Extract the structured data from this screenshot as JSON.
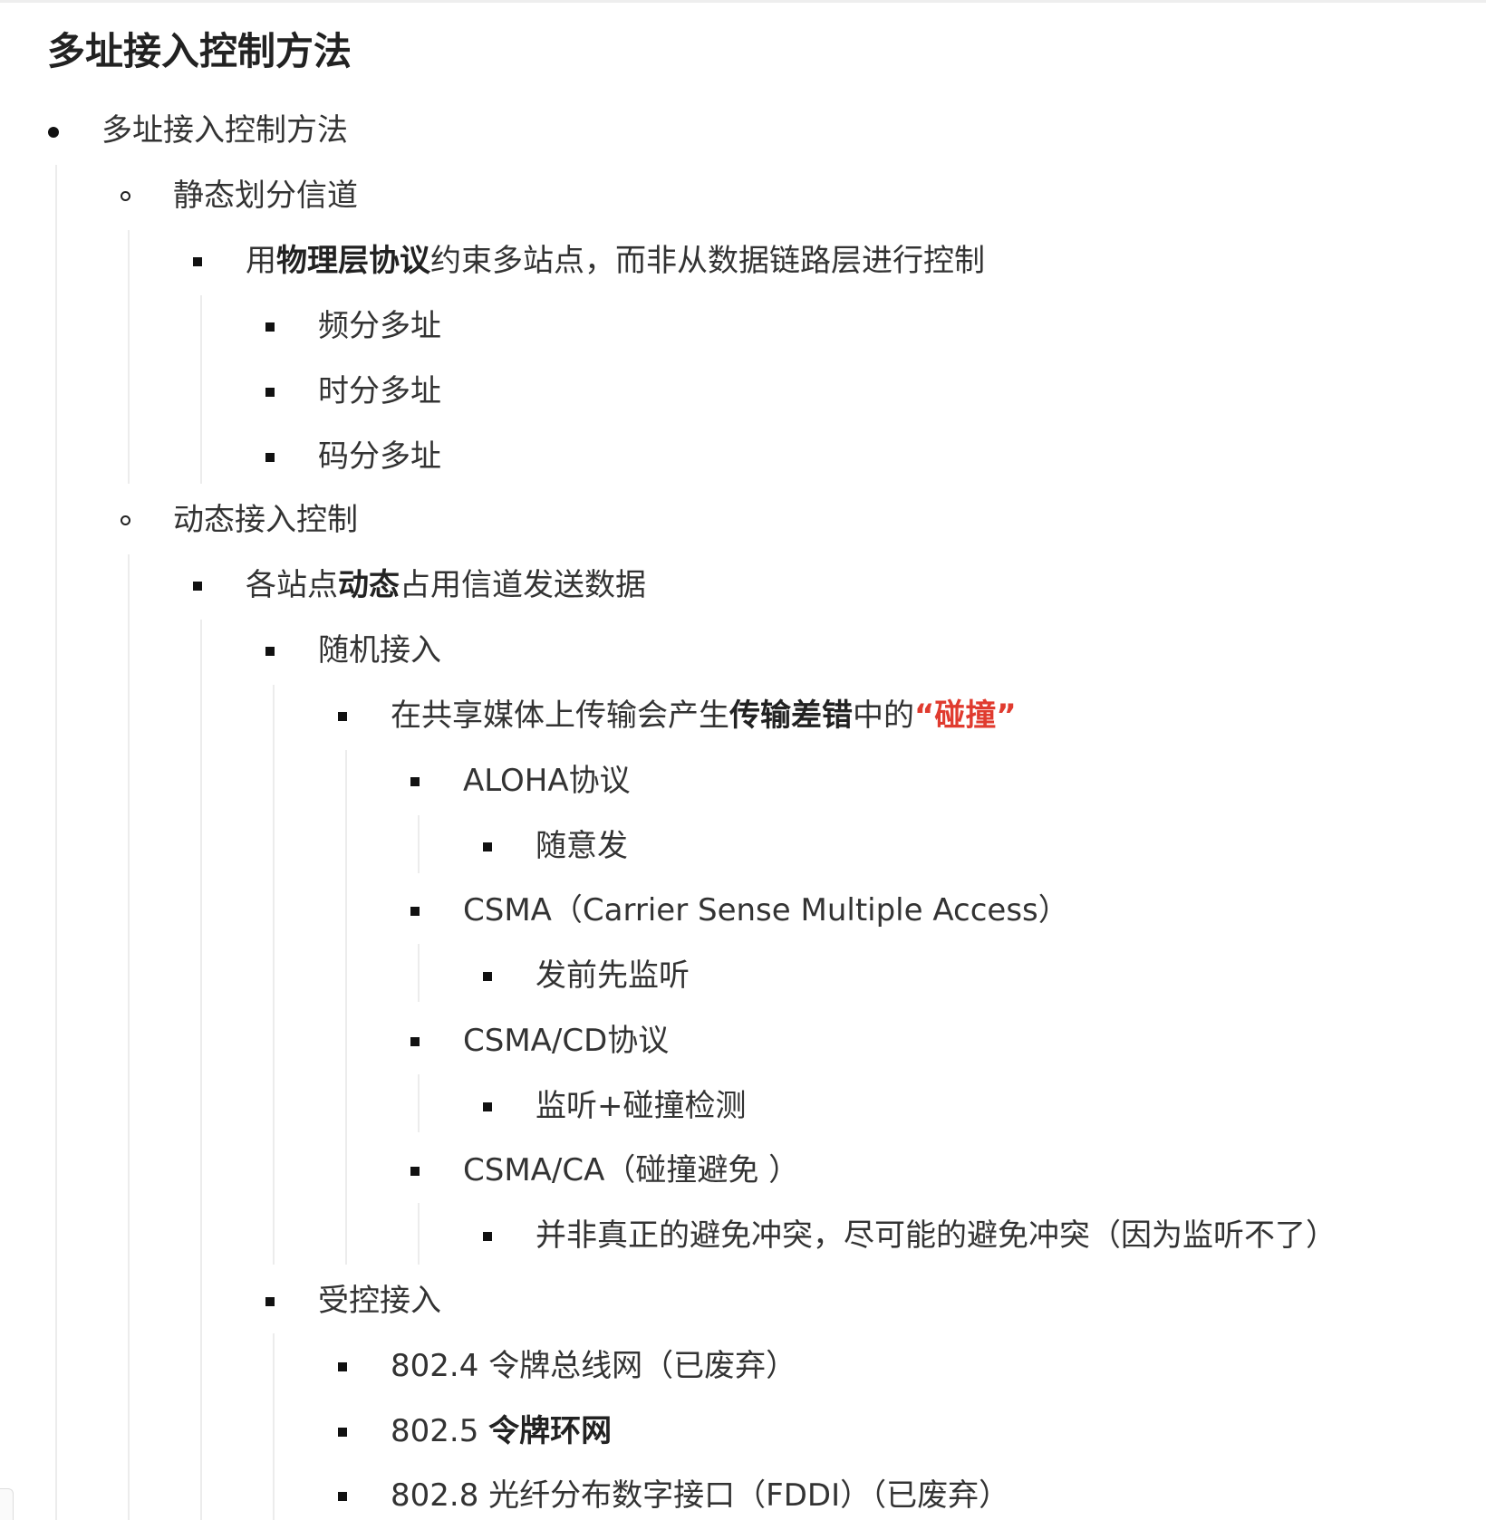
{
  "doc": {
    "title": "多址接入控制方法",
    "l1_label": "多址接入控制方法",
    "static": {
      "label": "静态划分信道",
      "desc_prefix": "用",
      "desc_bold": "物理层协议",
      "desc_suffix": "约束多站点，而非从数据链路层进行控制",
      "items": [
        "频分多址",
        "时分多址",
        "码分多址"
      ]
    },
    "dynamic": {
      "label": "动态接入控制",
      "desc_prefix": "各站点",
      "desc_bold": "动态",
      "desc_suffix": "占用信道发送数据",
      "random": {
        "label": "随机接入",
        "desc_prefix": "在共享媒体上传输会产生",
        "desc_bold": "传输差错",
        "desc_mid": "中的",
        "desc_red": "“碰撞”",
        "protocols": [
          {
            "name": "ALOHA协议",
            "detail": "随意发"
          },
          {
            "name": "CSMA（Carrier Sense Multiple Access）",
            "detail": "发前先监听"
          },
          {
            "name": "CSMA/CD协议",
            "detail": "监听+碰撞检测"
          },
          {
            "name": "CSMA/CA（碰撞避免 ）",
            "detail": "并非真正的避免冲突，尽可能的避免冲突（因为监听不了）"
          }
        ]
      },
      "controlled": {
        "label": "受控接入",
        "items": [
          {
            "prefix": "802.4 ",
            "text": "令牌总线网（已废弃）",
            "bold": false
          },
          {
            "prefix": "802.5 ",
            "text": "令牌环网",
            "bold": true
          },
          {
            "prefix": "802.8 ",
            "text": "光纤分布数字接口（FDDI）（已废弃）",
            "bold": false
          }
        ]
      }
    }
  },
  "colors": {
    "text": "#333333",
    "bold": "#222222",
    "accent_red": "#e03b2f",
    "guide_line": "#ececec"
  }
}
